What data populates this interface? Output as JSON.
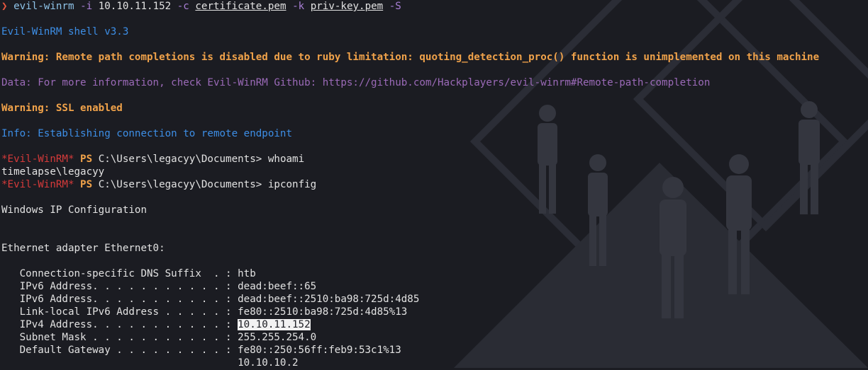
{
  "command_line": {
    "arrow": "❯",
    "program": "evil-winrm",
    "flag_i": "-i",
    "ip": "10.10.11.152",
    "flag_c": "-c",
    "cert": "certificate.pem",
    "flag_k": "-k",
    "key": "priv-key.pem",
    "flag_s": "-S"
  },
  "banner": "Evil-WinRM shell v3.3",
  "warning1": "Warning: Remote path completions is disabled due to ruby limitation: quoting_detection_proc() function is unimplemented on this machine",
  "data_line": "Data: For more information, check Evil-WinRM Github: https://github.com/Hackplayers/evil-winrm#Remote-path-completion",
  "warning2": "Warning: SSL enabled",
  "info": "Info: Establishing connection to remote endpoint",
  "prompt": {
    "name": "*Evil-WinRM*",
    "ps": "PS",
    "path": "C:\\Users\\legacyy\\Documents>"
  },
  "cmd1": "whoami",
  "whoami_out": "timelapse\\legacyy",
  "cmd2": "ipconfig",
  "ipconfig_title": "Windows IP Configuration",
  "adapter": "Ethernet adapter Ethernet0:",
  "rows": [
    {
      "label": "   Connection-specific DNS Suffix  . : ",
      "value": "htb"
    },
    {
      "label": "   IPv6 Address. . . . . . . . . . . : ",
      "value": "dead:beef::65"
    },
    {
      "label": "   IPv6 Address. . . . . . . . . . . : ",
      "value": "dead:beef::2510:ba98:725d:4d85"
    },
    {
      "label": "   Link-local IPv6 Address . . . . . : ",
      "value": "fe80::2510:ba98:725d:4d85%13"
    },
    {
      "label": "   IPv4 Address. . . . . . . . . . . : ",
      "value": "10.10.11.152"
    },
    {
      "label": "   Subnet Mask . . . . . . . . . . . : ",
      "value": "255.255.254.0"
    },
    {
      "label": "   Default Gateway . . . . . . . . . : ",
      "value": "fe80::250:56ff:feb9:53c1%13"
    },
    {
      "label": "                                       ",
      "value": "10.10.10.2"
    }
  ],
  "colors": {
    "background": "#1b1c22",
    "orange": "#f0a24a",
    "blue": "#3d8ee6",
    "purple": "#9b6ab8",
    "red": "#d63a3a"
  }
}
